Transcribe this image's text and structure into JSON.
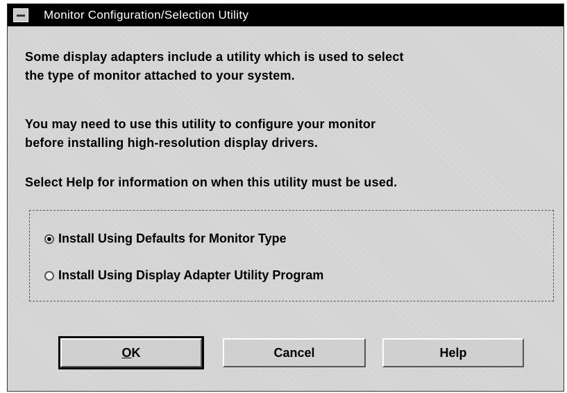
{
  "window": {
    "title": "Monitor Configuration/Selection Utility",
    "sysmenu_icon": "system-menu-icon"
  },
  "message": {
    "paragraph1": [
      "Some display adapters include a utility which is used to select",
      "the type of monitor attached to your system."
    ],
    "paragraph2": [
      "You may need to use this utility to configure your monitor",
      "before installing high-resolution display drivers."
    ],
    "paragraph3": [
      "Select Help for information on when this utility must be used."
    ]
  },
  "options": [
    {
      "label": "Install Using Defaults for Monitor Type",
      "selected": true
    },
    {
      "label": "Install Using Display Adapter Utility Program",
      "selected": false
    }
  ],
  "buttons": {
    "ok_mnemonic": "O",
    "ok_rest": "K",
    "cancel": "Cancel",
    "help": "Help"
  },
  "colors": {
    "titlebar_bg": "#000000",
    "titlebar_text": "#ffffff",
    "dialog_bg": "#dadada"
  }
}
